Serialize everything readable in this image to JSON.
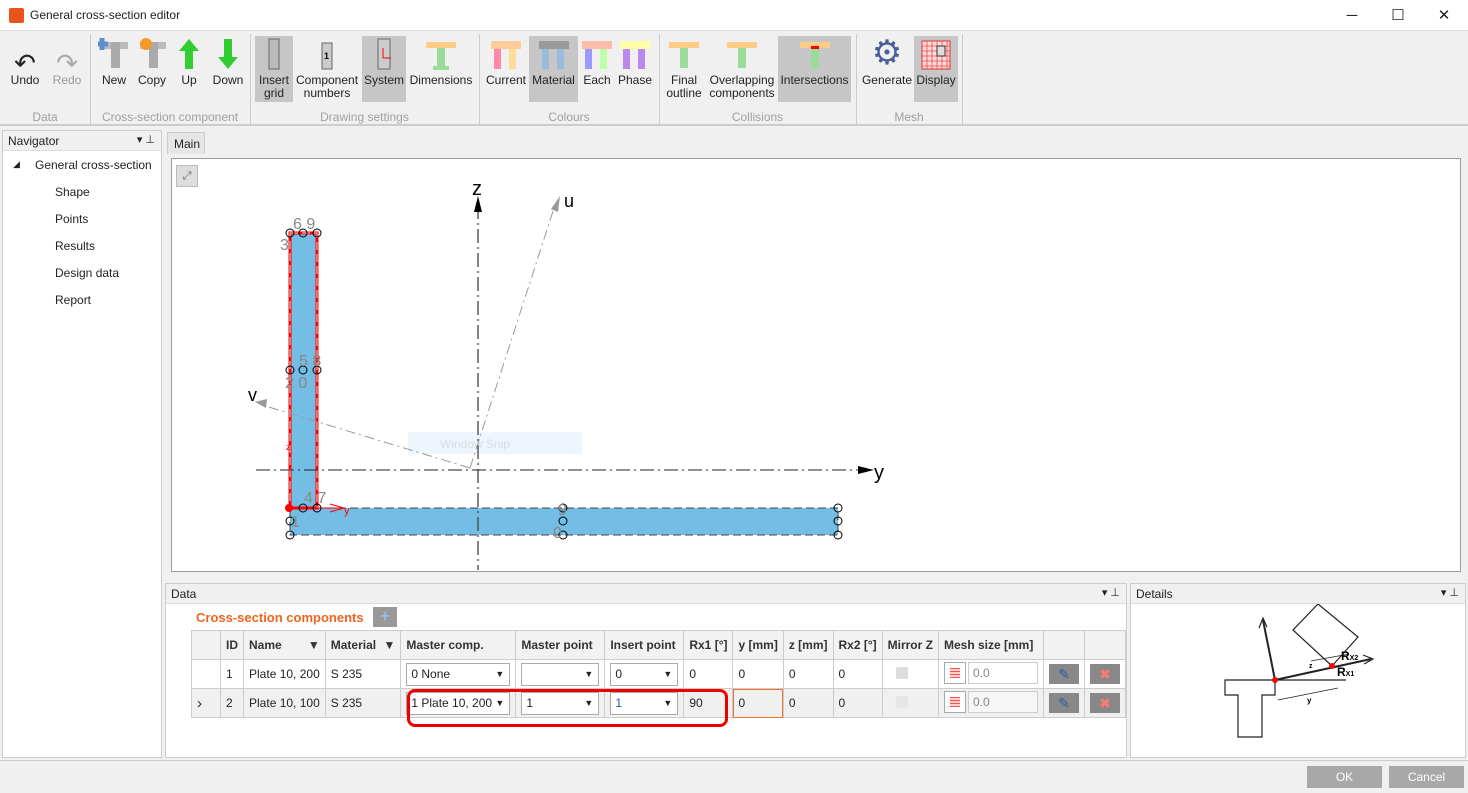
{
  "window": {
    "title": "General cross-section editor",
    "minimize": "─",
    "maximize": "☐",
    "close": "✕"
  },
  "ribbon": {
    "groups": [
      "Data",
      "Cross-section component",
      "Drawing settings",
      "Colours",
      "Collisions",
      "Mesh"
    ],
    "undo": "Undo",
    "redo": "Redo",
    "new": "New",
    "copy": "Copy",
    "up": "Up",
    "down": "Down",
    "insert_grid": [
      "Insert",
      "grid"
    ],
    "component_numbers": [
      "Component",
      "numbers"
    ],
    "system": "System",
    "dimensions": "Dimensions",
    "current": "Current",
    "material": "Material",
    "each": "Each",
    "phase": "Phase",
    "final_outline": [
      "Final",
      "outline"
    ],
    "overlapping": [
      "Overlapping",
      "components"
    ],
    "intersections": "Intersections",
    "generate": "Generate",
    "display": "Display"
  },
  "navigator": {
    "title": "Navigator",
    "root": "General cross-section",
    "items": [
      "Shape",
      "Points",
      "Results",
      "Design data",
      "Report"
    ]
  },
  "main_tab": "Main",
  "drawing": {
    "axis_z": "z",
    "axis_y": "y",
    "axis_u": "u",
    "axis_v": "v",
    "local_y": "y",
    "local_z": "z",
    "pts_top": "6 9",
    "pt_3": "3",
    "pts_mid": "5 8",
    "pts_mid2": "2 0",
    "pts_bot": "4 7",
    "pt_1": "1",
    "pts_right": "9",
    "pt_0": "0",
    "ghost": "Window Snip",
    "fill": "#74bde5",
    "outline": "#ff0000"
  },
  "data_panel": {
    "title": "Data",
    "section_title": "Cross-section components",
    "columns": [
      "",
      "ID",
      "Name",
      "Material",
      "Master comp.",
      "Master point",
      "Insert point",
      "Rx1 [°]",
      "y [mm]",
      "z [mm]",
      "Rx2 [°]",
      "Mirror Z",
      "Mesh size [mm]",
      "",
      ""
    ],
    "rows": [
      {
        "marker": "",
        "id": "1",
        "name": "Plate 10, 200",
        "material": "S 235",
        "master_comp": "0 None",
        "master_point": "",
        "insert_point": "0",
        "rx1": "0",
        "y": "0",
        "z": "0",
        "rx2": "0",
        "mesh": "0.0"
      },
      {
        "marker": "›",
        "id": "2",
        "name": "Plate 10, 100",
        "material": "S 235",
        "master_comp": "1 Plate 10, 200",
        "master_point": "1",
        "insert_point": "1",
        "rx1": "90",
        "y": "0",
        "z": "0",
        "rx2": "0",
        "mesh": "0.0"
      }
    ]
  },
  "details": {
    "title": "Details",
    "rx1": "R",
    "rx1_sub": "X1",
    "rx2": "R",
    "rx2_sub": "X2",
    "y": "y",
    "z": "z"
  },
  "footer": {
    "ok": "OK",
    "cancel": "Cancel"
  }
}
